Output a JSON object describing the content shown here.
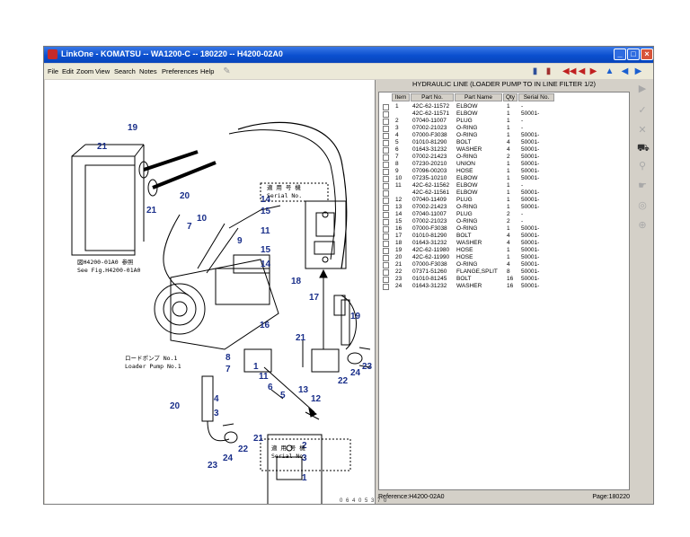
{
  "window": {
    "title": "LinkOne - KOMATSU -- WA1200-C -- 180220 -- H4200-02A0"
  },
  "menu": [
    "File",
    "Edit",
    "Zoom",
    "View",
    "Search",
    "Notes",
    "Preferences",
    "Help"
  ],
  "parts": {
    "header": "HYDRAULIC LINE (LOADER PUMP TO IN LINE FILTER 1/2)",
    "columns": [
      "Item",
      "Part No.",
      "Part Name",
      "Qty",
      "Serial No."
    ],
    "rows": [
      {
        "item": "1",
        "part": "42C-62-11572",
        "name": "ELBOW",
        "qty": "1",
        "serial": "-"
      },
      {
        "item": "",
        "part": "42C-62-11571",
        "name": "ELBOW",
        "qty": "1",
        "serial": "50001-"
      },
      {
        "item": "2",
        "part": "07040-11007",
        "name": "PLUG",
        "qty": "1",
        "serial": "-"
      },
      {
        "item": "3",
        "part": "07002-21023",
        "name": "O-RING",
        "qty": "1",
        "serial": "-"
      },
      {
        "item": "4",
        "part": "07000-F3038",
        "name": "O-RING",
        "qty": "1",
        "serial": "50001-"
      },
      {
        "item": "5",
        "part": "01010-81290",
        "name": "BOLT",
        "qty": "4",
        "serial": "50001-"
      },
      {
        "item": "6",
        "part": "01643-31232",
        "name": "WASHER",
        "qty": "4",
        "serial": "50001-"
      },
      {
        "item": "7",
        "part": "07002-21423",
        "name": "O-RING",
        "qty": "2",
        "serial": "50001-"
      },
      {
        "item": "8",
        "part": "07230-20210",
        "name": "UNION",
        "qty": "1",
        "serial": "50001-"
      },
      {
        "item": "9",
        "part": "07096-00203",
        "name": "HOSE",
        "qty": "1",
        "serial": "50001-"
      },
      {
        "item": "10",
        "part": "07235-10210",
        "name": "ELBOW",
        "qty": "1",
        "serial": "50001-"
      },
      {
        "item": "11",
        "part": "42C-62-11562",
        "name": "ELBOW",
        "qty": "1",
        "serial": "-"
      },
      {
        "item": "",
        "part": "42C-62-11561",
        "name": "ELBOW",
        "qty": "1",
        "serial": "50001-"
      },
      {
        "item": "12",
        "part": "07040-11409",
        "name": "PLUG",
        "qty": "1",
        "serial": "50001-"
      },
      {
        "item": "13",
        "part": "07002-21423",
        "name": "O-RING",
        "qty": "1",
        "serial": "50001-"
      },
      {
        "item": "14",
        "part": "07040-11007",
        "name": "PLUG",
        "qty": "2",
        "serial": "-"
      },
      {
        "item": "15",
        "part": "07002-21023",
        "name": "O-RING",
        "qty": "2",
        "serial": "-"
      },
      {
        "item": "16",
        "part": "07000-F3038",
        "name": "O-RING",
        "qty": "1",
        "serial": "50001-"
      },
      {
        "item": "17",
        "part": "01010-81290",
        "name": "BOLT",
        "qty": "4",
        "serial": "50001-"
      },
      {
        "item": "18",
        "part": "01643-31232",
        "name": "WASHER",
        "qty": "4",
        "serial": "50001-"
      },
      {
        "item": "19",
        "part": "42C-62-11980",
        "name": "HOSE",
        "qty": "1",
        "serial": "50001-"
      },
      {
        "item": "20",
        "part": "42C-62-11990",
        "name": "HOSE",
        "qty": "1",
        "serial": "50001-"
      },
      {
        "item": "21",
        "part": "07000-F3038",
        "name": "O-RING",
        "qty": "4",
        "serial": "50001-"
      },
      {
        "item": "22",
        "part": "07371-51260",
        "name": "FLANGE,SPLIT",
        "qty": "8",
        "serial": "50001-"
      },
      {
        "item": "23",
        "part": "01010-81245",
        "name": "BOLT",
        "qty": "16",
        "serial": "50001-"
      },
      {
        "item": "24",
        "part": "01643-31232",
        "name": "WASHER",
        "qty": "16",
        "serial": "50001-"
      }
    ]
  },
  "status": {
    "reference": "Reference:H4200-02A0",
    "page": "Page:180220"
  },
  "drawing": {
    "callouts": [
      "19",
      "21",
      "20",
      "21",
      "7",
      "10",
      "9",
      "14",
      "15",
      "11",
      "15",
      "14",
      "18",
      "17",
      "19",
      "16",
      "21",
      "8",
      "7",
      "11",
      "1",
      "6",
      "5",
      "13",
      "12",
      "22",
      "24",
      "23",
      "20",
      "4",
      "3",
      "22",
      "24",
      "23",
      "21",
      "2",
      "3",
      "1"
    ],
    "note_ref_jp": "図H4200-01A0 参照",
    "note_ref_en": "See Fig.H4200-01A0",
    "note_pump_jp": "ロードポンプ No.1",
    "note_pump_en": "Loader Pump No.1",
    "note_serial_jp": "適 用 号 機",
    "note_serial_en": "Serial No.",
    "footer_code": "0 6 4 0 5 3 7 0"
  }
}
